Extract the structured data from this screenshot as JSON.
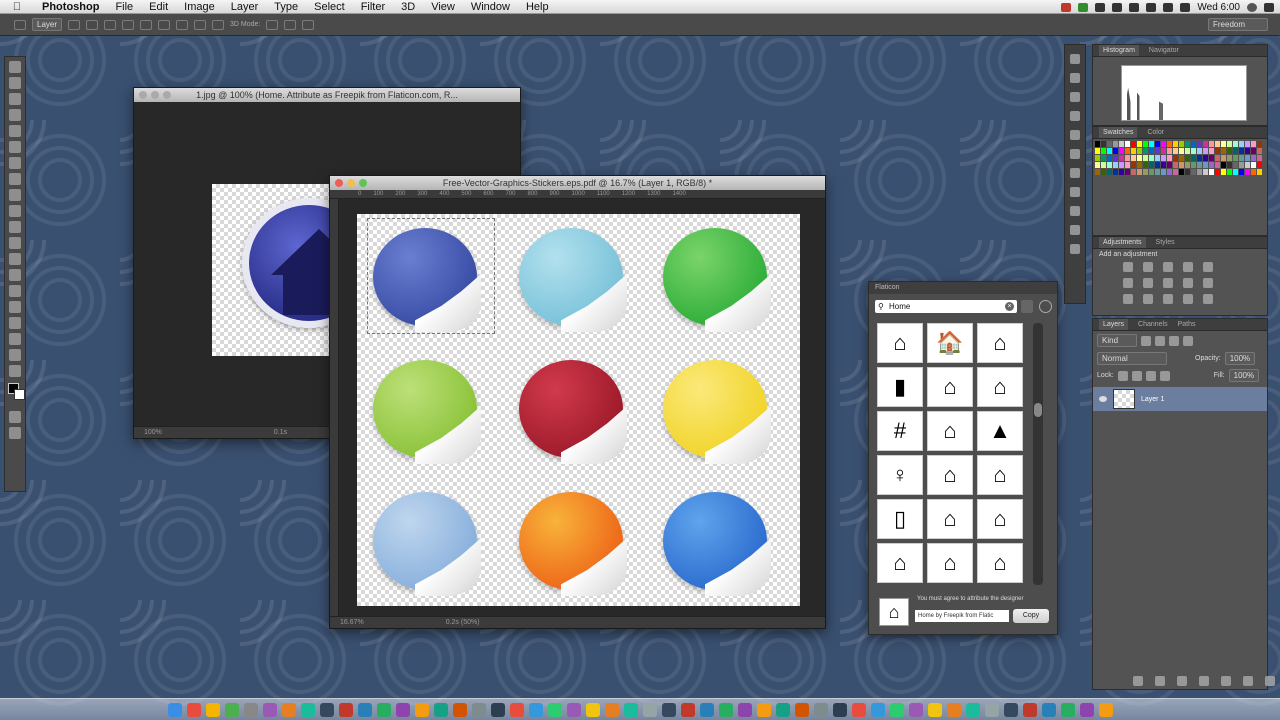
{
  "menubar": {
    "app": "Photoshop",
    "items": [
      "File",
      "Edit",
      "Image",
      "Layer",
      "Type",
      "Select",
      "Filter",
      "3D",
      "View",
      "Window",
      "Help"
    ],
    "clock": "Wed 6:00"
  },
  "options": {
    "layer_dropdown": "Layer",
    "mode_3d": "3D Mode:",
    "workspace": "Freedom"
  },
  "doc1": {
    "title": "1.jpg @ 100% (Home. Attribute as Freepik from Flaticon.com, R...",
    "zoom": "100%",
    "info": "0.1s"
  },
  "doc2": {
    "title": "Free-Vector-Graphics-Stickers.eps.pdf @ 16.7% (Layer 1, RGB/8) *",
    "zoom": "16.67%",
    "info": "0.2s (50%)",
    "ruler": [
      "0",
      "100",
      "200",
      "300",
      "400",
      "500",
      "600",
      "700",
      "800",
      "900",
      "1000",
      "1100",
      "1200",
      "1300",
      "1400"
    ],
    "stickers": [
      {
        "color": "#3b4fa8",
        "hi": "#6a7fd0"
      },
      {
        "color": "#7cc3da",
        "hi": "#b2e1ee"
      },
      {
        "color": "#32b03c",
        "hi": "#7bd46a"
      },
      {
        "color": "#8dc43c",
        "hi": "#bde079"
      },
      {
        "color": "#a01c2c",
        "hi": "#d13a4c"
      },
      {
        "color": "#f1d52e",
        "hi": "#fbe97a"
      },
      {
        "color": "#8bb2dd",
        "hi": "#bfd6ee"
      },
      {
        "color": "#ee6a1a",
        "hi": "#f8b33a"
      },
      {
        "color": "#2f6fd0",
        "hi": "#5fa4ec"
      }
    ]
  },
  "panels": {
    "histogram_tabs": [
      "Histogram",
      "Navigator"
    ],
    "swatches_tabs": [
      "Swatches",
      "Color"
    ],
    "adjust_tabs": [
      "Adjustments",
      "Styles"
    ],
    "adjust_hint": "Add an adjustment",
    "layers_tabs": [
      "Layers",
      "Channels",
      "Paths"
    ],
    "kind": "Kind",
    "blend": "Normal",
    "opacity_label": "Opacity:",
    "opacity": "100%",
    "lock_label": "Lock:",
    "fill_label": "Fill:",
    "fill": "100%",
    "layer_name": "Layer 1",
    "swatch_colors": [
      "#000000",
      "#333333",
      "#666666",
      "#999999",
      "#cccccc",
      "#ffffff",
      "#ff0000",
      "#ffff00",
      "#00ff00",
      "#00ffff",
      "#0000ff",
      "#ff00ff",
      "#ff6600",
      "#ffcc00",
      "#99cc00",
      "#009966",
      "#0066cc",
      "#6633cc",
      "#cc3399",
      "#ff9999",
      "#ffcc99",
      "#ffff99",
      "#ccff99",
      "#99ffcc",
      "#99ccff",
      "#cc99ff",
      "#ff99cc",
      "#993300",
      "#996600",
      "#336600",
      "#006666",
      "#003399",
      "#330099",
      "#660066",
      "#cc6666",
      "#cc9966",
      "#999966",
      "#669966",
      "#669999",
      "#6699cc",
      "#9966cc",
      "#cc6699"
    ]
  },
  "flaticon": {
    "title": "Flaticon",
    "search": "Home",
    "icons": [
      "⌂",
      "🏠",
      "⌂",
      "▮",
      "⌂",
      "⌂",
      "#",
      "⌂",
      "▲",
      "♀",
      "⌂",
      "⌂",
      "▯",
      "⌂",
      "⌂",
      "⌂",
      "⌂",
      "⌂"
    ],
    "attribute_note": "You must agree to attribute the designer",
    "attribution": "Home by Freepik from Flatic",
    "copy": "Copy"
  }
}
